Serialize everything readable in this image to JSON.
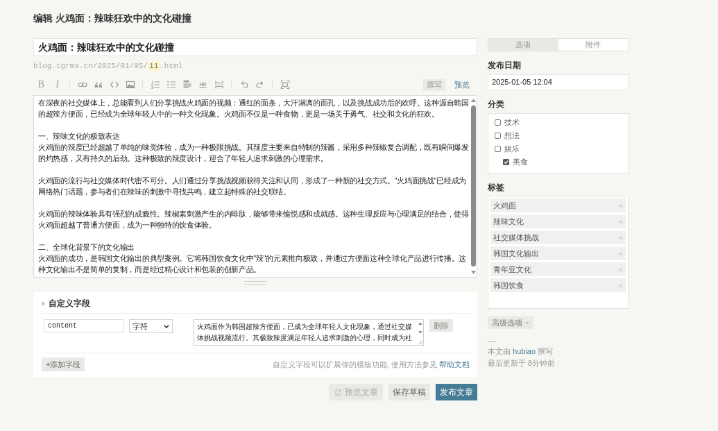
{
  "page": {
    "heading": "编辑 火鸡面：辣味狂欢中的文化碰撞"
  },
  "post": {
    "title": "火鸡面：辣味狂欢中的文化碰撞",
    "permalink": {
      "prefix": "blog.tgrmx.cn/2025/01/05/",
      "slug": "11",
      "suffix": ".html"
    },
    "toolbar": {
      "groups": [
        {
          "buttons": [
            {
              "kind": "bold",
              "label": "B"
            },
            {
              "kind": "italic",
              "label": "I"
            }
          ]
        },
        {
          "buttons": [
            {
              "kind": "link"
            },
            {
              "kind": "quote"
            },
            {
              "kind": "code"
            },
            {
              "kind": "image"
            }
          ]
        },
        {
          "buttons": [
            {
              "kind": "ordered-list"
            },
            {
              "kind": "bullet-list"
            },
            {
              "kind": "heading"
            },
            {
              "kind": "hr",
              "label": "HR"
            },
            {
              "kind": "more"
            }
          ]
        },
        {
          "buttons": [
            {
              "kind": "undo"
            },
            {
              "kind": "redo"
            }
          ]
        },
        {
          "buttons": [
            {
              "kind": "fullscreen"
            }
          ]
        }
      ],
      "modes": [
        {
          "label": "撰写",
          "selected": true
        },
        {
          "label": "预览",
          "selected": false
        }
      ]
    },
    "content": {
      "intro": [
        "在深夜的社交媒体上，总能看到人们分享挑战火鸡面的视频：通红的面条，大汗淋漓的面孔，以及挑战成功后的欢呼。这种源自韩国的超辣方便面，已经成为全球年轻人中的一种文化现象。火鸡面不仅是一种食物，更是一场关于勇气、社交和文化的狂欢。"
      ],
      "sections": [
        {
          "heading": "一、辣味文化的极致表达",
          "paragraphs": [
            "火鸡面的辣度已经超越了单纯的味觉体验，成为一种极限挑战。其辣度主要来自特制的辣酱，采用多种辣椒复合调配，既有瞬间爆发的灼热感，又有持久的后劲。这种极致的辣度设计，迎合了年轻人追求刺激的心理需求。",
            "火鸡面的流行与社交媒体时代密不可分。人们通过分享挑战视频获得关注和认同，形成了一种新的社交方式。\"火鸡面挑战\"已经成为网络热门话题，参与者们在辣味的刺激中寻找共鸣，建立起特殊的社交联结。",
            "火鸡面的辣味体验具有强烈的成瘾性。辣椒素刺激产生的内啡肽，能够带来愉悦感和成就感。这种生理反应与心理满足的结合，使得火鸡面超越了普通方便面，成为一种独特的饮食体验。"
          ]
        },
        {
          "heading": "二、全球化背景下的文化输出",
          "paragraphs": [
            "火鸡面的成功，是韩国文化输出的典型案例。它将韩国饮食文化中\"辣\"的元素推向极致，并通过方便面这种全球化产品进行传播。这种文化输出不是简单的复制，而是经过精心设计和包装的创新产品。"
          ]
        }
      ]
    }
  },
  "custom_fields": {
    "title": "自定义字段",
    "fields": [
      {
        "name": "content",
        "type": "字符",
        "value": "火鸡面作为韩国超辣方便面，已成为全球年轻人文化现象，通过社交媒体挑战视频流行。其极致辣度满足年轻人追求刺激的心理，同时成为社",
        "delete_label": "删除"
      }
    ],
    "add_label": "+添加字段",
    "help": {
      "text": "自定义字段可以扩展你的模板功能, 使用方法参见",
      "link": "帮助文档"
    }
  },
  "actions": [
    {
      "kind": "preview",
      "label": "预览文章"
    },
    {
      "kind": "draft",
      "label": "保存草稿"
    },
    {
      "kind": "publish",
      "label": "发布文章"
    }
  ],
  "sidebar": {
    "tabs": [
      {
        "label": "选项",
        "selected": true
      },
      {
        "label": "附件",
        "selected": false
      }
    ],
    "date": {
      "label": "发布日期",
      "value": "2025-01-05 12:04"
    },
    "categories": {
      "label": "分类",
      "items": [
        {
          "label": "技术",
          "checked": false
        },
        {
          "label": "想法",
          "checked": false
        },
        {
          "label": "娱乐",
          "checked": false,
          "children": [
            {
              "label": "美食",
              "checked": true
            }
          ]
        }
      ]
    },
    "tags": {
      "label": "标签",
      "items": [
        "火鸡面",
        "辣味文化",
        "社交媒体挑战",
        "韩国文化输出",
        "青年亚文化",
        "韩国饮食"
      ]
    },
    "advanced": {
      "label": "高级选项"
    },
    "separator": "—",
    "author_note": {
      "before": "本文由",
      "author": "hubiao",
      "after": "撰写"
    },
    "updated": "最后更新于 8分钟前"
  }
}
